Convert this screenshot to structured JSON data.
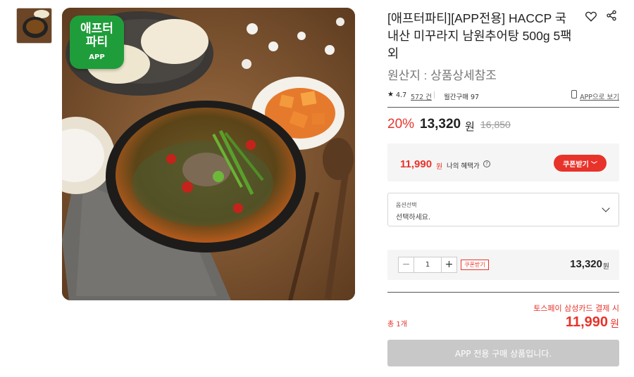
{
  "thumbnails": [
    {
      "alt": ""
    }
  ],
  "badge": {
    "line1": "애프터",
    "line2": "파티",
    "sub": "APP"
  },
  "product": {
    "title": "[애프터파티][APP전용] HACCP 국내산 미꾸라지 남원추어탕 500g 5팩 외",
    "origin": "원산지 : 상품상세참조"
  },
  "meta": {
    "star": "★",
    "rating": "4.7",
    "reviews": "572 건",
    "monthly": "월간구매 97",
    "app_link": "APP으로 보기"
  },
  "price": {
    "discount": "20%",
    "sale": "13,320",
    "won": "원",
    "original": "16,850"
  },
  "benefit": {
    "price": "11,990",
    "won": "원",
    "label": "나의 혜택가",
    "help": "?",
    "coupon_button": "쿠폰받기",
    "coupon_chevron": "﹀"
  },
  "option": {
    "label": "옵션선택",
    "placeholder": "선택하세요."
  },
  "quantity": {
    "minus": "−",
    "plus": "+",
    "value": "1",
    "coupon_tag": "쿠폰받기",
    "price": "13,320",
    "won": "원"
  },
  "summary": {
    "promo": "토스페이 삼성카드 결제 시",
    "total_label": "총 1개",
    "total_price": "11,990",
    "won": "원"
  },
  "buy_button": "APP 전용 구매 상품입니다.",
  "colors": {
    "accent_red": "#e8332a",
    "badge_green": "#1f9d3a",
    "disabled_gray": "#c8c8c8"
  }
}
